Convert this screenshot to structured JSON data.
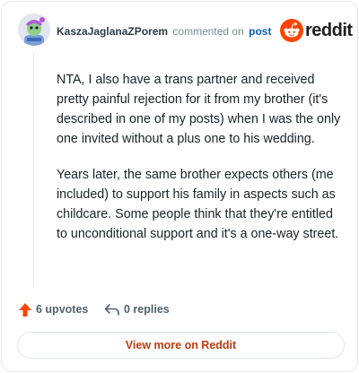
{
  "header": {
    "username": "KaszaJaglanaZPorem",
    "action_text": "commented on",
    "post_link": "post",
    "brand": "reddit"
  },
  "comment": {
    "paragraphs": [
      "NTA, I also have a trans partner and received pretty painful rejection for it from my brother (it's described in one of my posts) when I was the only one invited without a plus one to his wedding.",
      "Years later, the same brother expects others (me included) to support his family in aspects such as childcare. Some people think that they're entitled to unconditional support and it's a one-way street."
    ]
  },
  "actions": {
    "upvotes": "6 upvotes",
    "replies": "0 replies"
  },
  "footer": {
    "view_more": "View more on Reddit"
  },
  "colors": {
    "brand_orange": "#ff4500",
    "link_blue": "#0a5bc4",
    "view_more_text": "#c33a0c"
  },
  "icons": {
    "avatar": "snoo-avatar",
    "brand": "reddit-logo-icon",
    "upvote": "upvote-arrow-icon",
    "reply": "reply-arrow-icon"
  }
}
